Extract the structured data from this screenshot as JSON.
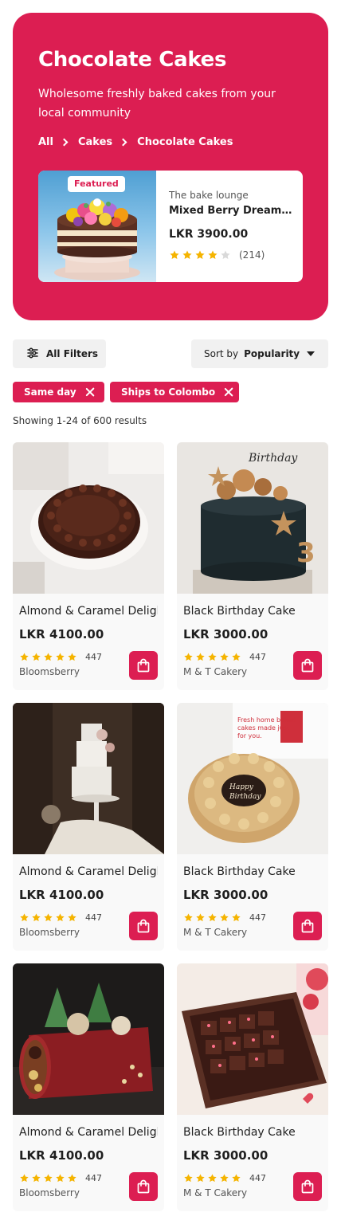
{
  "hero": {
    "title": "Chocolate Cakes",
    "subtitle": "Wholesome freshly baked cakes from your local community",
    "breadcrumb": [
      "All",
      "Cakes",
      "Chocolate Cakes"
    ],
    "featured": {
      "badge": "Featured",
      "shop": "The bake lounge",
      "name": "Mixed Berry Dream Cake",
      "price": "LKR 3900.00",
      "rating": 4,
      "rating_count": "(214)"
    }
  },
  "toolbar": {
    "filters_label": "All Filters",
    "sort_prefix": "Sort by",
    "sort_value": "Popularity"
  },
  "chips": [
    "Same day",
    "Ships to Colombo"
  ],
  "results_text": "Showing 1-24 of 600 results",
  "products": [
    {
      "name": "Almond & Caramel Delight",
      "price": "LKR 4100.00",
      "rating": 5,
      "count": "447",
      "shop": "Bloomsberry",
      "image": "chocolate-ganache-cake"
    },
    {
      "name": "Black Birthday Cake",
      "price": "LKR 3000.00",
      "rating": 5,
      "count": "447",
      "shop": "M & T Cakery",
      "image": "black-birthday-cake"
    },
    {
      "name": "Almond & Caramel Delight",
      "price": "LKR 4100.00",
      "rating": 5,
      "count": "447",
      "shop": "Bloomsberry",
      "image": "white-tiered-cake"
    },
    {
      "name": "Black Birthday Cake",
      "price": "LKR 3000.00",
      "rating": 5,
      "count": "447",
      "shop": "M & T Cakery",
      "image": "caramel-birthday-cake"
    },
    {
      "name": "Almond & Caramel Delight",
      "price": "LKR 4100.00",
      "rating": 5,
      "count": "447",
      "shop": "Bloomsberry",
      "image": "red-log-cake"
    },
    {
      "name": "Black Birthday Cake",
      "price": "LKR 3000.00",
      "rating": 5,
      "count": "447",
      "shop": "M & T Cakery",
      "image": "brownie-box"
    }
  ],
  "colors": {
    "brand": "#dc1e52",
    "star": "#f5b400",
    "star_empty": "#d9d9d9",
    "card_bg": "#f9f9f9"
  },
  "icons": [
    "chevron-right-icon",
    "sliders-icon",
    "caret-down-icon",
    "close-icon",
    "star-icon",
    "shopping-bag-icon"
  ]
}
